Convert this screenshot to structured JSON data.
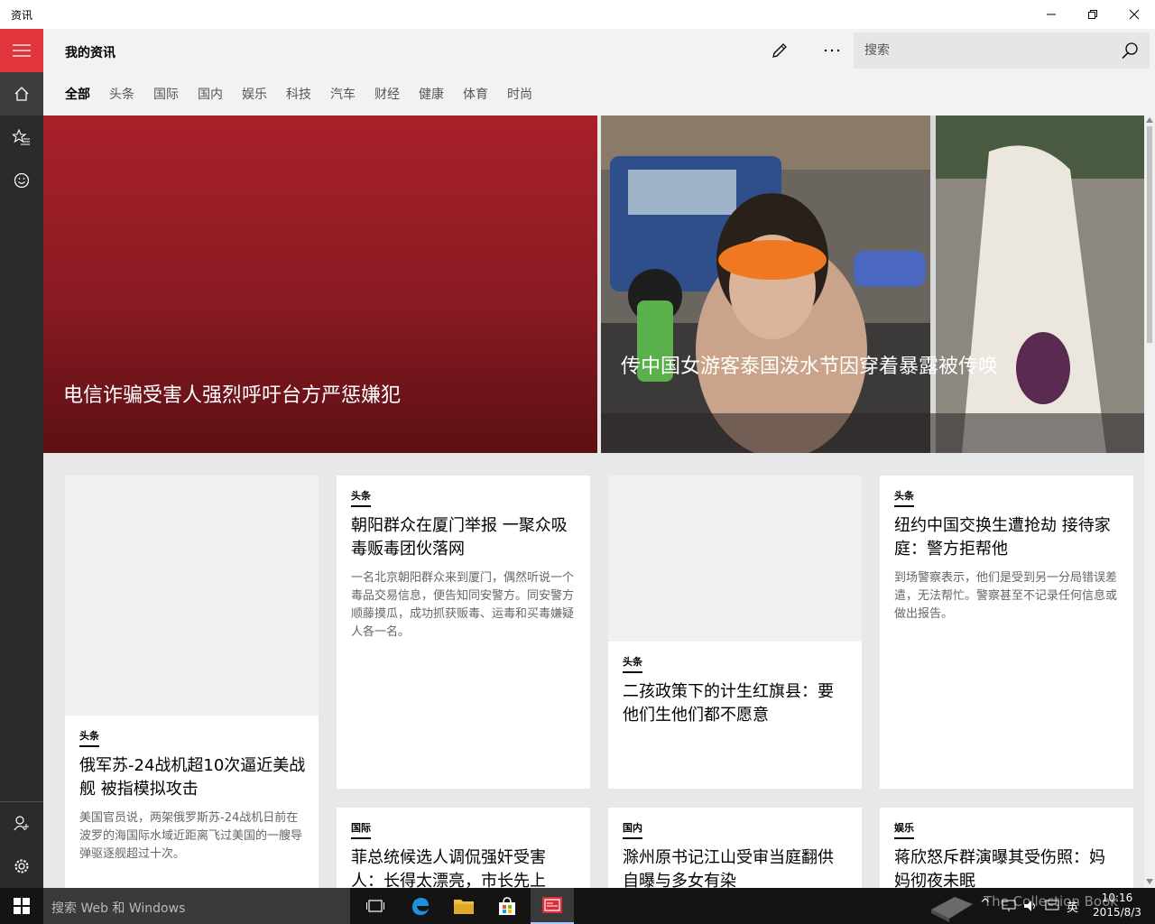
{
  "window": {
    "title": "资讯"
  },
  "header": {
    "title": "我的资讯"
  },
  "search": {
    "placeholder": "搜索"
  },
  "tabs": [
    "全部",
    "头条",
    "国际",
    "国内",
    "娱乐",
    "科技",
    "汽车",
    "财经",
    "健康",
    "体育",
    "时尚"
  ],
  "active_tab": "全部",
  "hero": [
    {
      "title": "电信诈骗受害人强烈呼吁台方严惩嫌犯"
    },
    {
      "title": "传中国女游客泰国泼水节因穿着暴露被传唤"
    }
  ],
  "cards": [
    {
      "tag": "头条",
      "title": "俄军苏-24战机超10次逼近美战舰 被指模拟攻击",
      "summary": "美国官员说，两架俄罗斯苏-24战机日前在波罗的海国际水域近距离飞过美国的一艘导弹驱逐舰超过十次。"
    },
    {
      "tag": "头条",
      "title": "朝阳群众在厦门举报 一聚众吸毒贩毒团伙落网",
      "summary": "一名北京朝阳群众来到厦门，偶然听说一个毒品交易信息，便告知同安警方。同安警方顺藤摸瓜，成功抓获贩毒、运毒和买毒嫌疑人各一名。"
    },
    {
      "tag": "头条",
      "title": "二孩政策下的计生红旗县：要他们生他们都不愿意"
    },
    {
      "tag": "头条",
      "title": "纽约中国交换生遭抢劫 接待家庭：警方拒帮他",
      "summary": "到场警察表示，他们是受到另一分局错误差遣，无法帮忙。警察甚至不记录任何信息或做出报告。"
    },
    {
      "tag": "国际",
      "title": "菲总统候选人调侃强奸受害人：长得太漂亮，市长先上"
    },
    {
      "tag": "国内",
      "title": "滁州原书记江山受审当庭翻供 自曝与多女有染"
    },
    {
      "tag": "娱乐",
      "title": "蒋欣怒斥群演曝其受伤照：妈妈彻夜未眠"
    }
  ],
  "taskbar": {
    "search_placeholder": "搜索 Web 和 Windows",
    "time": "10:16",
    "date": "2015/8/3",
    "ime": "英",
    "watermark": "The Collection Book"
  },
  "colors": {
    "accent": "#e0353c",
    "rail": "#2b2b2b",
    "hero_red": "#a8202a",
    "taskbar": "#141414"
  }
}
